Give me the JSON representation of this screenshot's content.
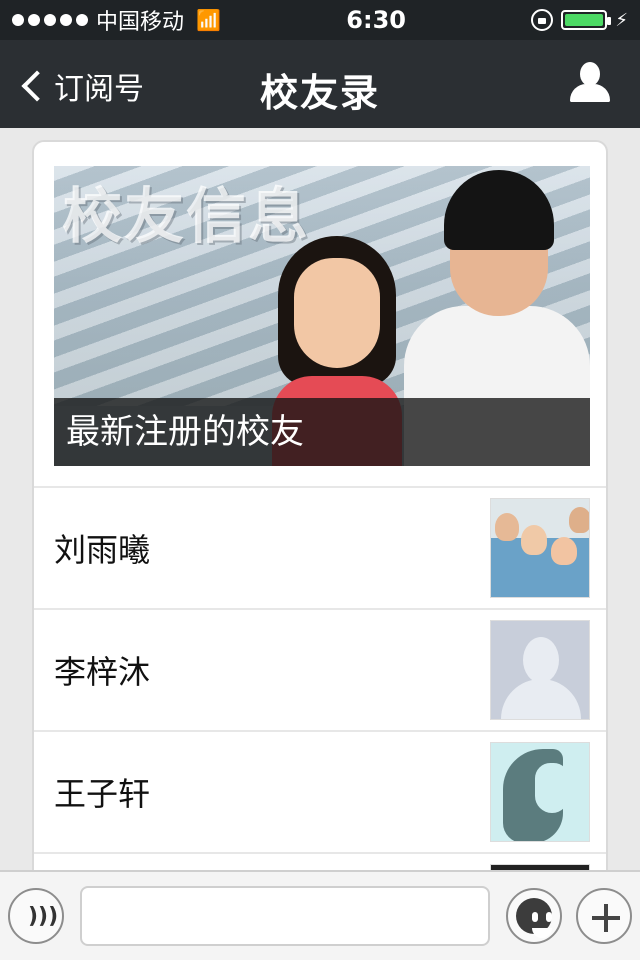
{
  "status_bar": {
    "carrier": "中国移动",
    "time": "6:30"
  },
  "nav": {
    "back_label": "订阅号",
    "title": "校友录"
  },
  "banner": {
    "overlay_text": "校友信息",
    "caption": "最新注册的校友"
  },
  "alumni": [
    {
      "name": "刘雨曦",
      "thumb": "group-photo"
    },
    {
      "name": "李梓沐",
      "thumb": "default-avatar"
    },
    {
      "name": "王子轩",
      "thumb": "silhouette-avatar"
    }
  ],
  "colors": {
    "status_bar_bg": "#1f2326",
    "nav_bg": "#2b2f33",
    "battery_green": "#4cd964"
  },
  "icons": [
    "back-chevron-icon",
    "profile-icon",
    "wifi-icon",
    "orientation-lock-icon",
    "battery-icon",
    "voice-icon",
    "emoji-icon",
    "plus-icon"
  ]
}
